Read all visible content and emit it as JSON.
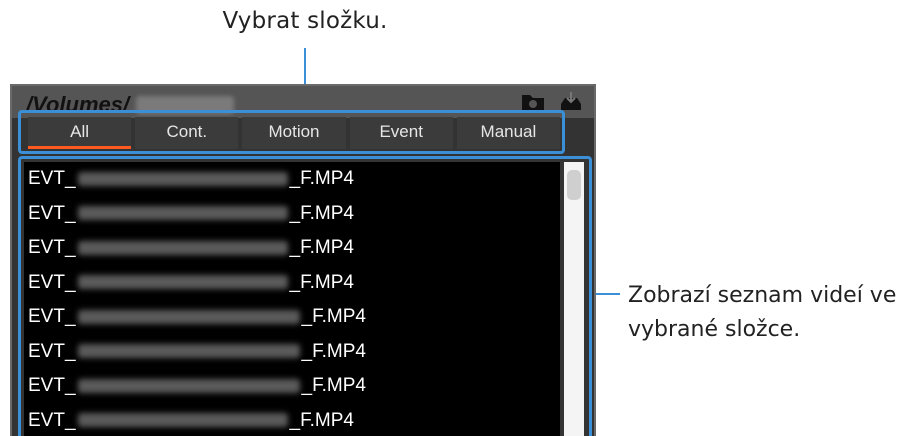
{
  "callouts": {
    "top": "Vybrat složku.",
    "right_line1": "Zobrazí seznam videí ve",
    "right_line2": "vybrané složce."
  },
  "window": {
    "path": "/Volumes/"
  },
  "tabs": [
    {
      "label": "All",
      "active": true
    },
    {
      "label": "Cont.",
      "active": false
    },
    {
      "label": "Motion",
      "active": false
    },
    {
      "label": "Event",
      "active": false
    },
    {
      "label": "Manual",
      "active": false
    }
  ],
  "files": [
    {
      "prefix": "EVT_",
      "suffix": "_F.MP4"
    },
    {
      "prefix": "EVT_",
      "suffix": "_F.MP4"
    },
    {
      "prefix": "EVT_",
      "suffix": "_F.MP4"
    },
    {
      "prefix": "EVT_",
      "suffix": "_F.MP4"
    },
    {
      "prefix": "EVT_",
      "suffix": "_F.MP4"
    },
    {
      "prefix": "EVT_",
      "suffix": "_F.MP4"
    },
    {
      "prefix": "EVT_",
      "suffix": "_F.MP4"
    },
    {
      "prefix": "EVT_",
      "suffix": "_F.MP4"
    }
  ],
  "colors": {
    "accent": "#3a8fd6",
    "active_tab": "#ff5a1f"
  },
  "icons": {
    "folder": "folder-icon",
    "download": "download-icon"
  }
}
